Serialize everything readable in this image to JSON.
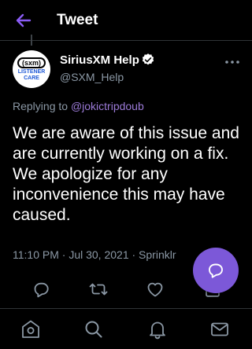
{
  "header": {
    "title": "Tweet",
    "back_icon": "arrow-left-icon",
    "accent": "#8b5cf6"
  },
  "tweet": {
    "author_name": "SiriusXM Help",
    "author_handle": "@SXM_Help",
    "verified": true,
    "avatar": {
      "logo_text": "(sxm)",
      "sub_text": "LISTENER CARE"
    },
    "replying_prefix": "Replying to",
    "replying_to": "@jokictripdoub",
    "text": "We are aware of this issue and are currently working on a fix. We apologize for any inconvenience this may have caused.",
    "meta": "11:10 PM · Jul 30, 2021 · Sprinklr"
  },
  "actions": [
    "reply-icon",
    "retweet-icon",
    "like-icon",
    "share-icon"
  ],
  "compose_button": {
    "icon": "compose-icon",
    "color": "#7c58d8"
  },
  "bottom_nav": [
    "home-icon",
    "search-icon",
    "notifications-icon",
    "messages-icon"
  ]
}
